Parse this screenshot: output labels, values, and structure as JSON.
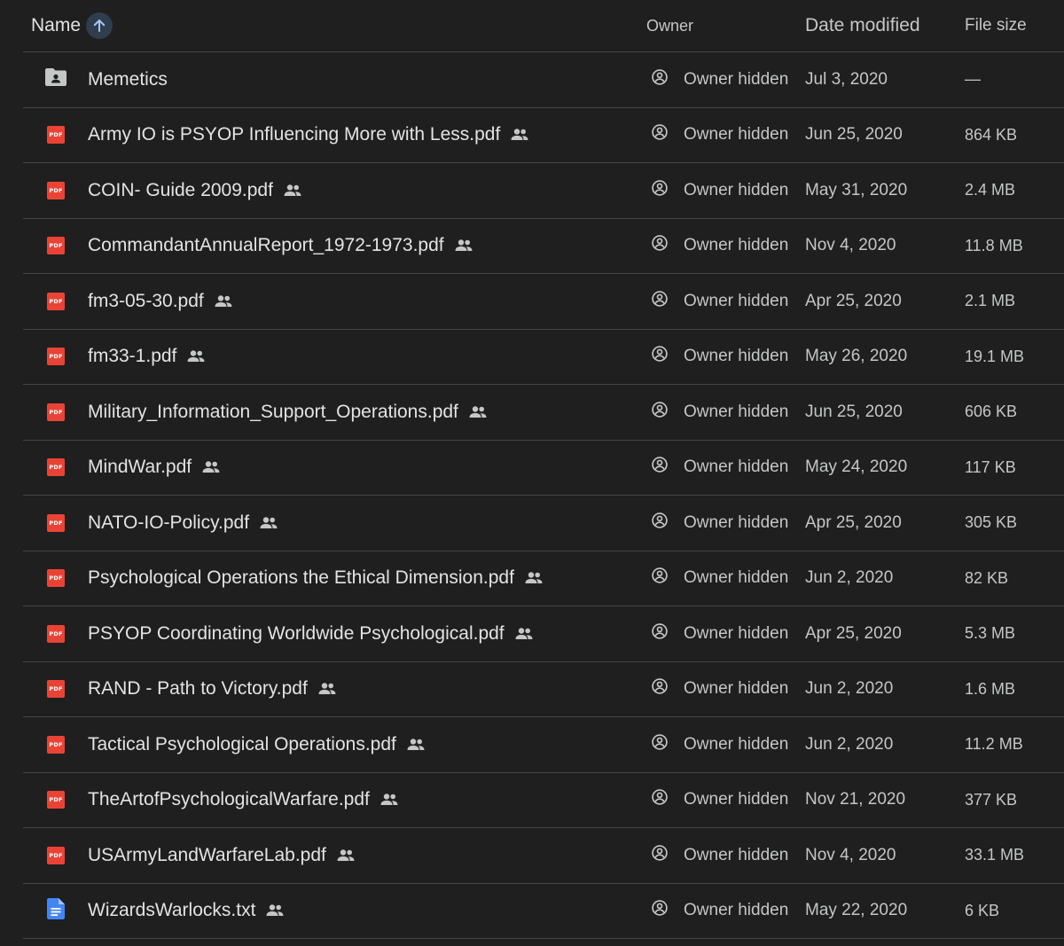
{
  "header": {
    "name_label": "Name",
    "owner_label": "Owner",
    "date_label": "Date modified",
    "size_label": "File size",
    "sort_icon": "arrow-up-icon"
  },
  "colors": {
    "background": "#1f1f1f",
    "divider": "#444746",
    "pdf_red": "#ea4335",
    "doc_blue": "#4285f4",
    "sort_button_bg": "#2f3d4c",
    "sort_arrow": "#a8c7fa"
  },
  "files": [
    {
      "type": "folder",
      "icon": "shared-folder-icon",
      "name": "Memetics",
      "shared": false,
      "owner": "Owner hidden",
      "date": "Jul 3, 2020",
      "size": "—"
    },
    {
      "type": "pdf",
      "icon": "pdf-icon",
      "icon_text": "PDF",
      "name": "Army IO is PSYOP Influencing More with Less.pdf",
      "shared": true,
      "owner": "Owner hidden",
      "date": "Jun 25, 2020",
      "size": "864 KB"
    },
    {
      "type": "pdf",
      "icon": "pdf-icon",
      "icon_text": "PDF",
      "name": "COIN- Guide 2009.pdf",
      "shared": true,
      "owner": "Owner hidden",
      "date": "May 31, 2020",
      "size": "2.4 MB"
    },
    {
      "type": "pdf",
      "icon": "pdf-icon",
      "icon_text": "PDF",
      "name": "CommandantAnnualReport_1972-1973.pdf",
      "shared": true,
      "owner": "Owner hidden",
      "date": "Nov 4, 2020",
      "size": "11.8 MB"
    },
    {
      "type": "pdf",
      "icon": "pdf-icon",
      "icon_text": "PDF",
      "name": "fm3-05-30.pdf",
      "shared": true,
      "owner": "Owner hidden",
      "date": "Apr 25, 2020",
      "size": "2.1 MB"
    },
    {
      "type": "pdf",
      "icon": "pdf-icon",
      "icon_text": "PDF",
      "name": "fm33-1.pdf",
      "shared": true,
      "owner": "Owner hidden",
      "date": "May 26, 2020",
      "size": "19.1 MB"
    },
    {
      "type": "pdf",
      "icon": "pdf-icon",
      "icon_text": "PDF",
      "name": "Military_Information_Support_Operations.pdf",
      "shared": true,
      "owner": "Owner hidden",
      "date": "Jun 25, 2020",
      "size": "606 KB"
    },
    {
      "type": "pdf",
      "icon": "pdf-icon",
      "icon_text": "PDF",
      "name": "MindWar.pdf",
      "shared": true,
      "owner": "Owner hidden",
      "date": "May 24, 2020",
      "size": "117 KB"
    },
    {
      "type": "pdf",
      "icon": "pdf-icon",
      "icon_text": "PDF",
      "name": "NATO-IO-Policy.pdf",
      "shared": true,
      "owner": "Owner hidden",
      "date": "Apr 25, 2020",
      "size": "305 KB"
    },
    {
      "type": "pdf",
      "icon": "pdf-icon",
      "icon_text": "PDF",
      "name": "Psychological Operations the Ethical Dimension.pdf",
      "shared": true,
      "owner": "Owner hidden",
      "date": "Jun 2, 2020",
      "size": "82 KB"
    },
    {
      "type": "pdf",
      "icon": "pdf-icon",
      "icon_text": "PDF",
      "name": "PSYOP Coordinating Worldwide Psychological.pdf",
      "shared": true,
      "owner": "Owner hidden",
      "date": "Apr 25, 2020",
      "size": "5.3 MB"
    },
    {
      "type": "pdf",
      "icon": "pdf-icon",
      "icon_text": "PDF",
      "name": "RAND - Path to Victory.pdf",
      "shared": true,
      "owner": "Owner hidden",
      "date": "Jun 2, 2020",
      "size": "1.6 MB"
    },
    {
      "type": "pdf",
      "icon": "pdf-icon",
      "icon_text": "PDF",
      "name": "Tactical Psychological Operations.pdf",
      "shared": true,
      "owner": "Owner hidden",
      "date": "Jun 2, 2020",
      "size": "11.2 MB"
    },
    {
      "type": "pdf",
      "icon": "pdf-icon",
      "icon_text": "PDF",
      "name": "TheArtofPsychologicalWarfare.pdf",
      "shared": true,
      "owner": "Owner hidden",
      "date": "Nov 21, 2020",
      "size": "377 KB"
    },
    {
      "type": "pdf",
      "icon": "pdf-icon",
      "icon_text": "PDF",
      "name": "USArmyLandWarfareLab.pdf",
      "shared": true,
      "owner": "Owner hidden",
      "date": "Nov 4, 2020",
      "size": "33.1 MB"
    },
    {
      "type": "text",
      "icon": "text-document-icon",
      "name": "WizardsWarlocks.txt",
      "shared": true,
      "owner": "Owner hidden",
      "date": "May 22, 2020",
      "size": "6 KB"
    }
  ]
}
